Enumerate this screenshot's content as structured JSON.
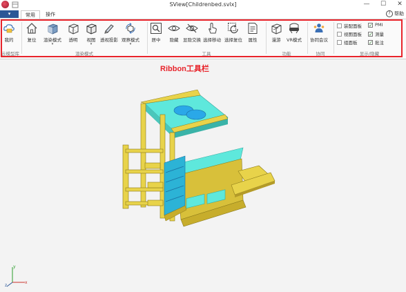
{
  "window": {
    "title": "SView[Childrenbed.svlx]",
    "min": "—",
    "max": "☐",
    "close": "✕"
  },
  "tabs": {
    "file": "▾",
    "items": [
      {
        "label": "常用"
      },
      {
        "label": "操作"
      }
    ],
    "help": "帮助"
  },
  "ribbon": {
    "cloud": {
      "label": "云模型库",
      "buttons": [
        {
          "label": "我的"
        }
      ]
    },
    "render": {
      "label": "渲染模式",
      "buttons": [
        {
          "label": "复位"
        },
        {
          "label": "渲染模式"
        },
        {
          "label": "透明"
        },
        {
          "label": "视图"
        },
        {
          "label": "透视投影"
        },
        {
          "label": "观察模式"
        }
      ]
    },
    "tools": {
      "label": "工具",
      "buttons": [
        {
          "label": "居中"
        },
        {
          "label": "隐藏"
        },
        {
          "label": "显隐交换"
        },
        {
          "label": "选择移动"
        },
        {
          "label": "选择复位"
        },
        {
          "label": "属性"
        }
      ]
    },
    "function": {
      "label": "功能",
      "buttons": [
        {
          "label": "漫游"
        },
        {
          "label": "VR模式"
        }
      ]
    },
    "collab": {
      "label": "协同",
      "buttons": [
        {
          "label": "协同会议"
        }
      ]
    },
    "display": {
      "label": "显示/隐藏",
      "checks_left": [
        {
          "label": "装配面板",
          "checked": false
        },
        {
          "label": "视图面板",
          "checked": false
        },
        {
          "label": "组面板",
          "checked": false
        }
      ],
      "checks_right": [
        {
          "label": "PMI",
          "checked": true
        },
        {
          "label": "测量",
          "checked": true
        },
        {
          "label": "批注",
          "checked": true
        }
      ]
    }
  },
  "annotation": {
    "text": "Ribbon工具栏",
    "color": "#e8232a"
  },
  "axes": {
    "x": "x",
    "y": "y",
    "z": "z"
  },
  "colors": {
    "ribbon_frame": "#e8232a",
    "bed_frame": "#e8d34a",
    "mattress": "#5ee8dc",
    "pillow": "#2aa8e8"
  }
}
